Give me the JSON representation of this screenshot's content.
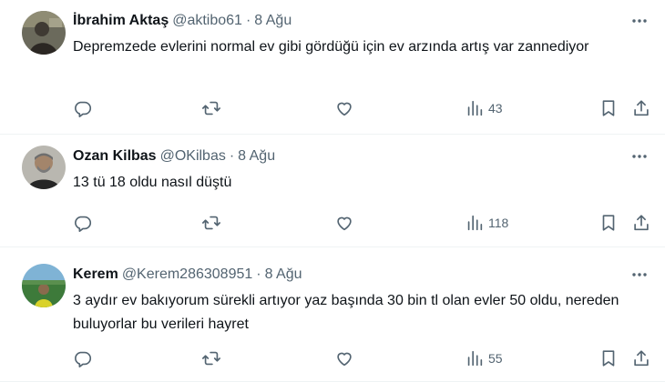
{
  "tweets": [
    {
      "name": "İbrahim Aktaş",
      "handle": "@aktibo61",
      "dot": "·",
      "date": "8 Ağu",
      "text": "Depremzede evlerini normal ev gibi gördüğü için ev arzında artış var zannediyor",
      "views": "43"
    },
    {
      "name": "Ozan Kilbas",
      "handle": "@OKilbas",
      "dot": "·",
      "date": "8 Ağu",
      "text": "13 tü 18 oldu nasıl düştü",
      "views": "118"
    },
    {
      "name": "Kerem",
      "handle": "@Kerem286308951",
      "dot": "·",
      "date": "8 Ağu",
      "text": "3 aydır ev bakıyorum sürekli artıyor yaz başında 30 bin tl olan evler 50 oldu, nereden buluyorlar bu verileri hayret",
      "views": "55"
    }
  ],
  "icons": {
    "reply": "reply-icon",
    "retweet": "retweet-icon",
    "like": "heart-icon",
    "views": "views-bar-chart-icon",
    "bookmark": "bookmark-icon",
    "share": "share-icon",
    "more": "more-dots-icon"
  },
  "colors": {
    "text": "#0f1419",
    "secondary": "#536471",
    "divider": "#eff3f4"
  }
}
